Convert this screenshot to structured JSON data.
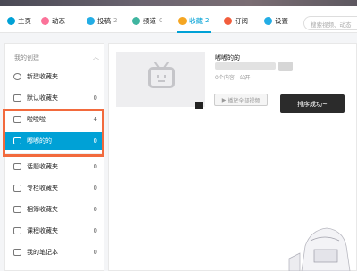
{
  "nav": {
    "items": [
      {
        "label": "主页",
        "count": "",
        "color": "#00a1d6"
      },
      {
        "label": "动态",
        "count": "",
        "color": "#fb7299"
      },
      {
        "label": "投稿",
        "count": "2",
        "color": "#23ade5"
      },
      {
        "label": "频道",
        "count": "0",
        "color": "#3fb5a0"
      },
      {
        "label": "收藏",
        "count": "2",
        "color": "#f5a623"
      },
      {
        "label": "订阅",
        "count": "",
        "color": "#f25d3c"
      },
      {
        "label": "设置",
        "count": "",
        "color": "#23ade5"
      }
    ],
    "search_placeholder": "搜索视频、动态"
  },
  "sidebar": {
    "section_title": "我的创建",
    "new_folder": "新建收藏夹",
    "folders": [
      {
        "label": "默认收藏夹",
        "count": "0"
      },
      {
        "label": "啦啦啦",
        "count": "4"
      },
      {
        "label": "嘟嘟的的",
        "count": "0"
      }
    ],
    "other": [
      {
        "label": "话题收藏夹",
        "count": "0"
      },
      {
        "label": "专栏收藏夹",
        "count": "0"
      },
      {
        "label": "相簿收藏夹",
        "count": "0"
      },
      {
        "label": "课程收藏夹",
        "count": "0"
      },
      {
        "label": "我的笔记本",
        "count": "0"
      }
    ]
  },
  "main": {
    "folder_title": "嘟嘟的的",
    "meta": "0个内容 · 公开",
    "play_all_label": "播放全部视频",
    "toast": "排序成功~"
  },
  "colors": {
    "accent": "#00a1d6",
    "highlight": "#f26a3d"
  }
}
